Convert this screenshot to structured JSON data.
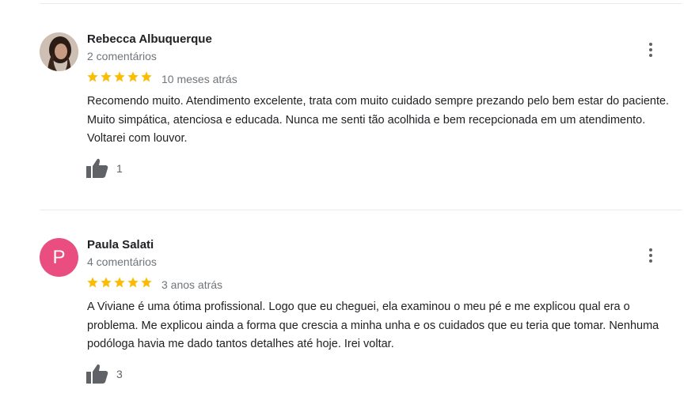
{
  "reviews": [
    {
      "name": "Rebecca Albuquerque",
      "comments": "2 comentários",
      "rating": 5,
      "date": "10 meses atrás",
      "text": "Recomendo muito. Atendimento excelente, trata com muito cuidado sempre prezando pelo bem estar do paciente. Muito simpática, atenciosa e educada. Nunca me senti tão acolhida e bem recepcionada em um atendimento. Voltarei com louvor.",
      "likes": "1",
      "avatar": "photo"
    },
    {
      "name": "Paula Salati",
      "comments": "4 comentários",
      "rating": 5,
      "date": "3 anos atrás",
      "text": "A Viviane é uma ótima profissional. Logo que eu cheguei, ela examinou o meu pé e me explicou qual era o problema. Me explicou ainda a forma que crescia a minha unha e os cuidados que eu teria que tomar. Nenhuma podóloga havia me dado tantos detalhes até hoje. Irei voltar.",
      "likes": "3",
      "avatar_letter": "P",
      "avatar_color": "#ea4d7f"
    }
  ],
  "colors": {
    "star": "#fbbc04",
    "muted": "#70757a",
    "icon": "#5f6368"
  },
  "icons": {
    "rating": "star-icon",
    "like": "thumbs-up-icon",
    "menu": "more-vert-icon"
  }
}
